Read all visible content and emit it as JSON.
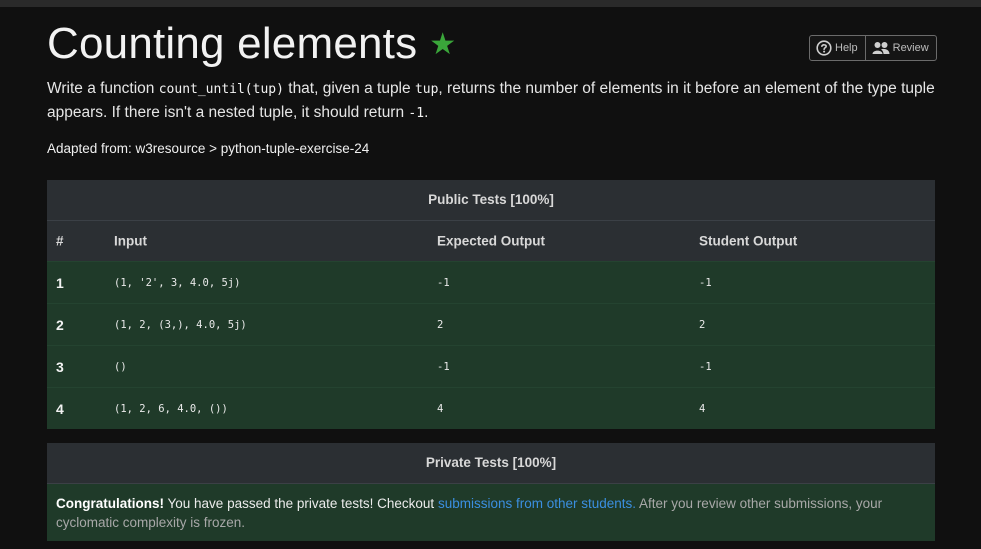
{
  "page": {
    "title": "Counting elements",
    "star": "★",
    "accent_color": "#3aa63a"
  },
  "toolbar": {
    "help_label": "Help",
    "help_icon": "question-circle-icon",
    "review_label": "Review",
    "review_icon": "users-icon"
  },
  "description": {
    "part1": "Write a function ",
    "code1": "count_until(tup)",
    "part2": " that, given a tuple ",
    "code2": "tup",
    "part3": ", returns the number of elements in it before an element of the type tuple appears. If there isn't a nested tuple, it should return ",
    "code3": "-1",
    "part4": "."
  },
  "adapted": "Adapted from: w3resource > python-tuple-exercise-24",
  "public_tests": {
    "header": "Public Tests [100%]",
    "columns": [
      "#",
      "Input",
      "Expected Output",
      "Student Output"
    ],
    "rows": [
      {
        "num": "1",
        "input": "(1, '2', 3, 4.0, 5j)",
        "expected": "-1",
        "student": "-1"
      },
      {
        "num": "2",
        "input": "(1, 2, (3,), 4.0, 5j)",
        "expected": "2",
        "student": "2"
      },
      {
        "num": "3",
        "input": "()",
        "expected": "-1",
        "student": "-1"
      },
      {
        "num": "4",
        "input": "(1, 2, 6, 4.0, ())",
        "expected": "4",
        "student": "4"
      }
    ],
    "pass_color": "#1f3a29"
  },
  "private_tests": {
    "header": "Private Tests [100%]",
    "congrats": "Congratulations!",
    "message": " You have passed the private tests! Checkout ",
    "link_text": "submissions from other students.",
    "note": " After you review other submissions, your cyclomatic complexity is frozen.",
    "link_color": "#3b8fe0"
  }
}
